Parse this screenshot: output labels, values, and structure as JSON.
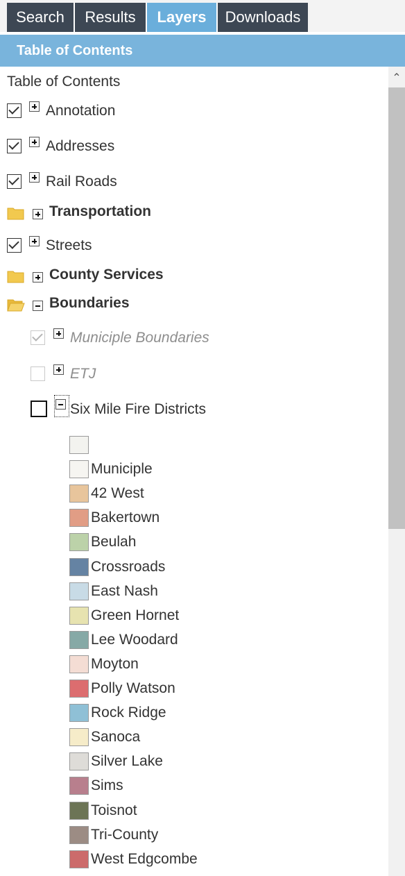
{
  "tabs": [
    {
      "label": "Search",
      "active": false
    },
    {
      "label": "Results",
      "active": false
    },
    {
      "label": "Layers",
      "active": true
    },
    {
      "label": "Downloads",
      "active": false
    }
  ],
  "section_header": "Table of Contents",
  "toc_title": "Table of Contents",
  "layers": [
    {
      "label": "Annotation",
      "checked": true
    },
    {
      "label": "Addresses",
      "checked": true
    },
    {
      "label": "Rail Roads",
      "checked": true
    },
    {
      "label": "Transportation",
      "group": true,
      "expanded": false
    },
    {
      "label": "Streets",
      "checked": true
    },
    {
      "label": "County Services",
      "group": true,
      "expanded": false
    },
    {
      "label": "Boundaries",
      "group": true,
      "expanded": true
    }
  ],
  "boundaries_children": [
    {
      "label": "Municiple Boundaries",
      "checked": true,
      "disabled": true
    },
    {
      "label": "ETJ",
      "checked": false,
      "disabled": true
    },
    {
      "label": "Six Mile Fire Districts",
      "checked": false,
      "expanded": true
    }
  ],
  "legend": [
    {
      "label": "",
      "color": "#f3f3ef"
    },
    {
      "label": "Municiple",
      "color": "#f6f5f1"
    },
    {
      "label": "42 West",
      "color": "#e8c59c"
    },
    {
      "label": "Bakertown",
      "color": "#e19d85"
    },
    {
      "label": "Beulah",
      "color": "#bcd2a9"
    },
    {
      "label": "Crossroads",
      "color": "#6583a3"
    },
    {
      "label": "East Nash",
      "color": "#c8dbe6"
    },
    {
      "label": "Green Hornet",
      "color": "#e7e3b0"
    },
    {
      "label": "Lee Woodard",
      "color": "#86a9a6"
    },
    {
      "label": "Moyton",
      "color": "#f4ddd4"
    },
    {
      "label": "Polly Watson",
      "color": "#dc6d6f"
    },
    {
      "label": "Rock Ridge",
      "color": "#8fc0d6"
    },
    {
      "label": "Sanoca",
      "color": "#f6ecc9"
    },
    {
      "label": "Silver Lake",
      "color": "#dedcd8"
    },
    {
      "label": "Sims",
      "color": "#b87f8d"
    },
    {
      "label": "Toisnot",
      "color": "#6c7455"
    },
    {
      "label": "Tri-County",
      "color": "#9c8c84"
    },
    {
      "label": "West Edgcombe",
      "color": "#cc6b6b"
    }
  ],
  "icons": {
    "scroll_up": "chevron-up-icon",
    "folder_closed": "folder-icon",
    "folder_open": "folder-open-icon",
    "expand": "plus-box-icon",
    "collapse": "minus-box-icon"
  },
  "colors": {
    "tab_bg": "#3d4754",
    "tab_active_bg": "#6aaedb",
    "header_bg": "#79b4dc",
    "folder": "#f2c94f"
  }
}
